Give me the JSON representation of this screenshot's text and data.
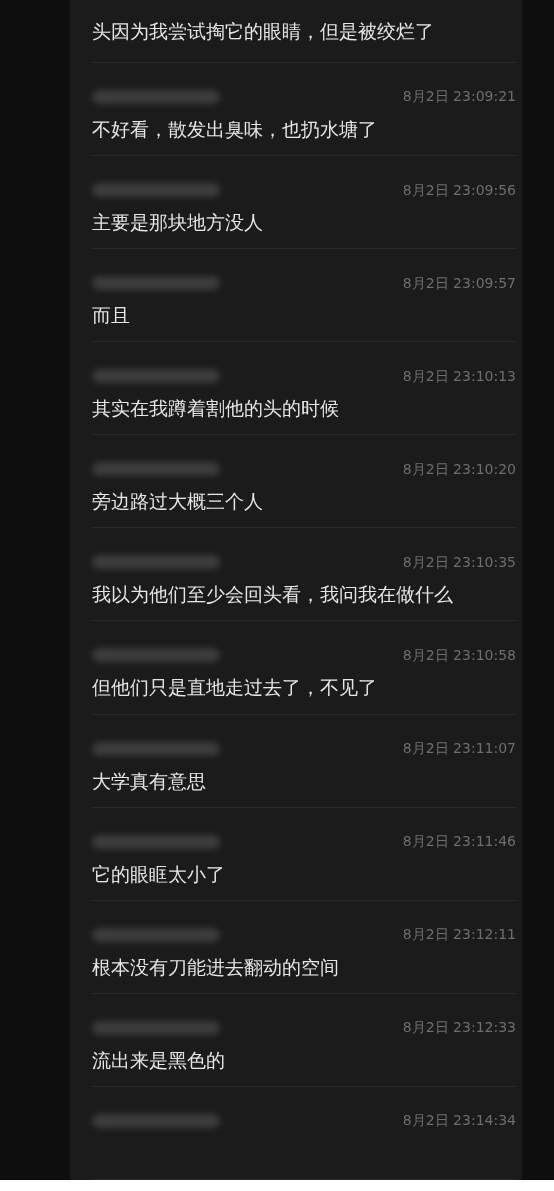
{
  "messages": [
    {
      "text": "头因为我尝试掏它的眼睛，但是被绞烂了"
    },
    {
      "time": "8月2日 23:09:21",
      "text": "不好看，散发出臭味，也扔水塘了"
    },
    {
      "time": "8月2日 23:09:56",
      "text": "主要是那块地方没人"
    },
    {
      "time": "8月2日 23:09:57",
      "text": "而且"
    },
    {
      "time": "8月2日 23:10:13",
      "text": "其实在我蹲着割他的头的时候"
    },
    {
      "time": "8月2日 23:10:20",
      "text": "旁边路过大概三个人"
    },
    {
      "time": "8月2日 23:10:35",
      "text": "我以为他们至少会回头看，我问我在做什么"
    },
    {
      "time": "8月2日 23:10:58",
      "text": "但他们只是直地走过去了，不见了"
    },
    {
      "time": "8月2日 23:11:07",
      "text": "大学真有意思"
    },
    {
      "time": "8月2日 23:11:46",
      "text": "它的眼眶太小了"
    },
    {
      "time": "8月2日 23:12:11",
      "text": "根本没有刀能进去翻动的空间"
    },
    {
      "time": "8月2日 23:12:33",
      "text": "流出来是黑色的"
    },
    {
      "time": "8月2日 23:14:34"
    }
  ]
}
